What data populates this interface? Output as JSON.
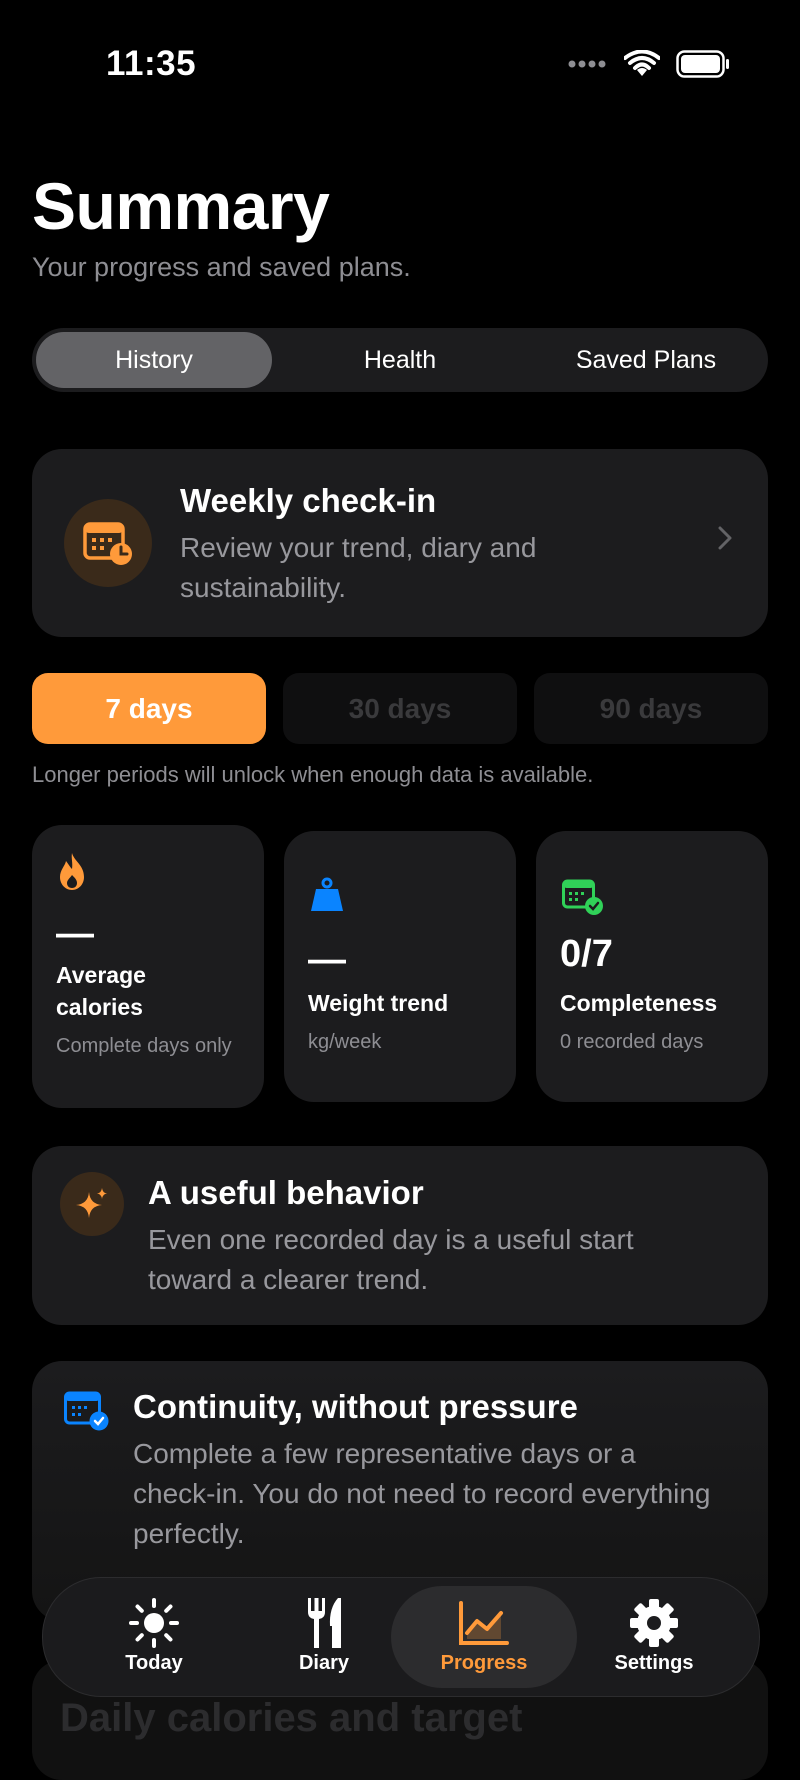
{
  "status": {
    "time": "11:35"
  },
  "header": {
    "title": "Summary",
    "subtitle": "Your progress and saved plans."
  },
  "segments": {
    "items": [
      "History",
      "Health",
      "Saved Plans"
    ],
    "selected": "History"
  },
  "checkin": {
    "title": "Weekly check-in",
    "description": "Review your trend, diary and sustainability.",
    "icon": "calendar-clock-icon"
  },
  "period": {
    "options": [
      "7 days",
      "30 days",
      "90 days"
    ],
    "selected": "7 days",
    "note": "Longer periods will unlock when enough data is available."
  },
  "stats": [
    {
      "icon": "flame-icon",
      "value": "—",
      "label": "Average calories",
      "sub": "Complete days only",
      "color": "#ff9a3a"
    },
    {
      "icon": "weight-icon",
      "value": "—",
      "label": "Weight trend",
      "sub": "kg/week",
      "color": "#0a84ff"
    },
    {
      "icon": "calendar-check-icon",
      "value": "0/7",
      "label": "Completeness",
      "sub": "0 recorded days",
      "color": "#30d158"
    }
  ],
  "behavior": {
    "title": "A useful behavior",
    "description": "Even one recorded day is a useful start toward a clearer trend.",
    "icon": "sparkles-icon"
  },
  "continuity": {
    "title": "Continuity, without pressure",
    "description": "Complete a few representative days or a check-in. You do not need to record everything perfectly.",
    "icon": "calendar-check-icon"
  },
  "next_section": {
    "title": "Daily calories and target"
  },
  "tabbar": {
    "items": [
      {
        "label": "Today",
        "icon": "sun-icon"
      },
      {
        "label": "Diary",
        "icon": "fork-knife-icon"
      },
      {
        "label": "Progress",
        "icon": "chart-icon"
      },
      {
        "label": "Settings",
        "icon": "gear-icon"
      }
    ],
    "selected": "Progress",
    "accent": "#ff9a3a"
  }
}
